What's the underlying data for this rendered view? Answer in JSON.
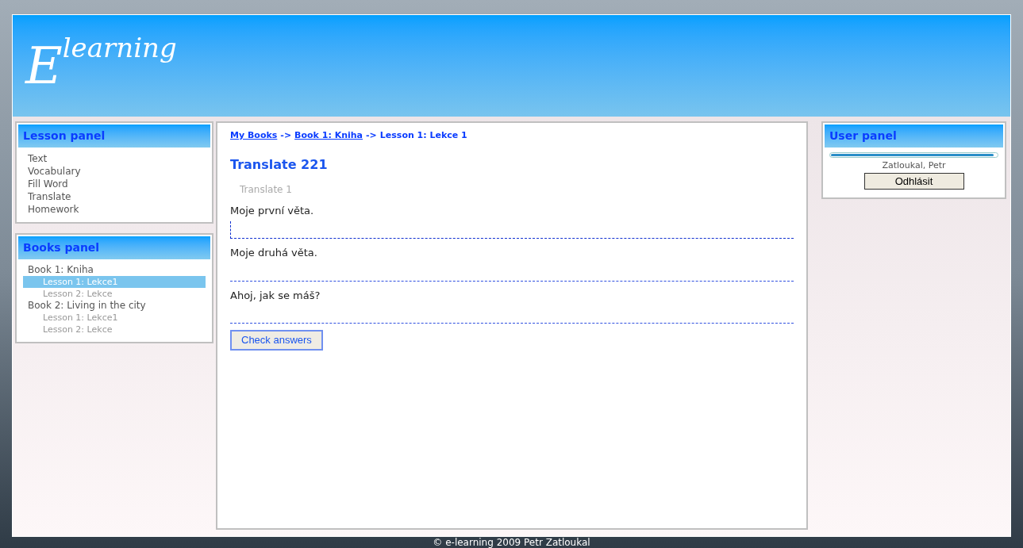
{
  "header": {
    "logo_initial": "E",
    "logo_rest": "learning"
  },
  "lesson_panel": {
    "title": "Lesson panel",
    "items": [
      "Text",
      "Vocabulary",
      "Fill Word",
      "Translate",
      "Homework"
    ]
  },
  "books_panel": {
    "title": "Books panel",
    "books": [
      {
        "label": "Book 1: Kniha",
        "children": [
          {
            "label": "Lesson 1: Lekce1",
            "selected": true
          },
          {
            "label": "Lesson 2: Lekce",
            "selected": false
          }
        ]
      },
      {
        "label": "Book 2: Living in the city",
        "children": [
          {
            "label": "Lesson 1: Lekce1",
            "selected": false
          },
          {
            "label": "Lesson 2: Lekce",
            "selected": false
          }
        ]
      }
    ]
  },
  "breadcrumb": [
    {
      "label": "My Books",
      "link": true
    },
    {
      "label": "->",
      "link": false
    },
    {
      "label": "Book 1: Kniha",
      "link": true
    },
    {
      "label": "->",
      "link": false
    },
    {
      "label": "Lesson 1: Lekce 1",
      "link": false
    }
  ],
  "exercise": {
    "title": "Translate 221",
    "subtitle": "Translate 1",
    "sentences": [
      {
        "text": "Moje první věta.",
        "focused": true
      },
      {
        "text": "Moje druhá věta.",
        "focused": false
      },
      {
        "text": "Ahoj, jak se máš?",
        "focused": false
      }
    ],
    "button": "Check answers"
  },
  "user_panel": {
    "title": "User panel",
    "level": 0.98,
    "user": "Zatloukal, Petr",
    "button": "Odhlásit"
  },
  "footer": "© e-learning 2009 Petr Zatloukal"
}
